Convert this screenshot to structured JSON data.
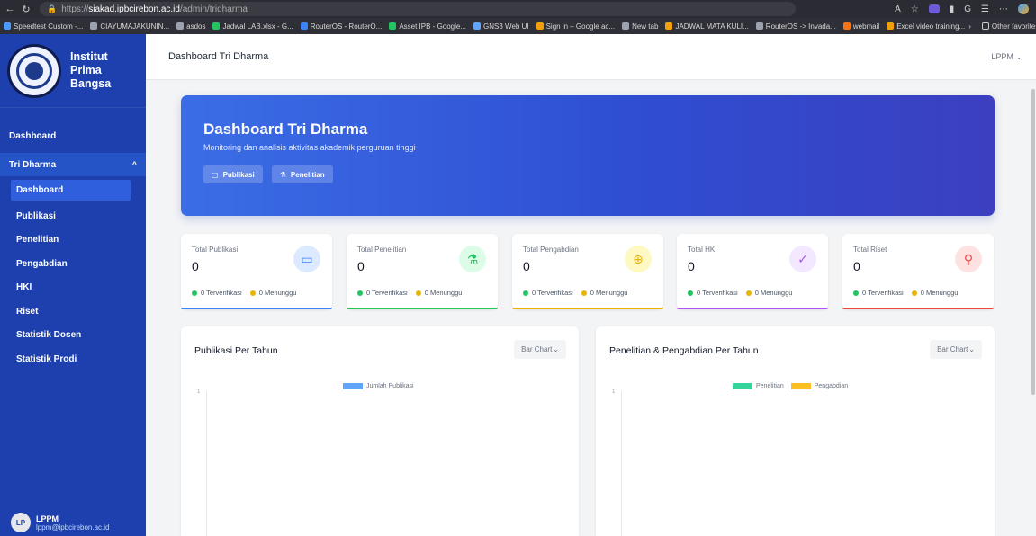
{
  "browser": {
    "url_prefix": "https://",
    "url_host": "siakad.ipbcirebon.ac.id",
    "url_path": "/admin/tridharma",
    "bookmarks": [
      {
        "label": "Speedtest Custom -...",
        "color": "#4b9bff"
      },
      {
        "label": "CIAYUMAJAKUNIN...",
        "color": "#9ca3af"
      },
      {
        "label": "asdos",
        "color": "#9ca3af"
      },
      {
        "label": "Jadwal LAB.xlsx - G...",
        "color": "#22c55e"
      },
      {
        "label": "RouterOS - RouterO...",
        "color": "#3b82f6"
      },
      {
        "label": "Asset IPB - Google...",
        "color": "#22c55e"
      },
      {
        "label": "GNS3 Web UI",
        "color": "#60a5fa"
      },
      {
        "label": "Sign in – Google ac...",
        "color": "#f59e0b"
      },
      {
        "label": "New tab",
        "color": "#9ca3af"
      },
      {
        "label": "JADWAL MATA KULI...",
        "color": "#f59e0b"
      },
      {
        "label": "RouterOS -> Invada...",
        "color": "#9ca3af"
      },
      {
        "label": "webmail",
        "color": "#f97316"
      },
      {
        "label": "Excel video training...",
        "color": "#f59e0b"
      }
    ],
    "other_favorites": "Other favorites"
  },
  "sidebar": {
    "brand_line1": "Institut",
    "brand_line2": "Prima",
    "brand_line3": "Bangsa",
    "dashboard": "Dashboard",
    "group": "Tri Dharma",
    "items": [
      "Dashboard",
      "Publikasi",
      "Penelitian",
      "Pengabdian",
      "HKI",
      "Riset",
      "Statistik Dosen",
      "Statistik Prodi"
    ],
    "user_initials": "LP",
    "user_name": "LPPM",
    "user_email": "lppm@ipbcirebon.ac.id"
  },
  "header": {
    "title": "Dashboard Tri Dharma",
    "user_menu": "LPPM"
  },
  "hero": {
    "title": "Dashboard Tri Dharma",
    "subtitle": "Monitoring dan analisis aktivitas akademik perguruan tinggi",
    "btn_publikasi": "Publikasi",
    "btn_penelitian": "Penelitian"
  },
  "stats": [
    {
      "label": "Total Publikasi",
      "value": "0",
      "verified": "0 Terverifikasi",
      "pending": "0 Menunggu",
      "icon": "book-icon",
      "color": "#3b82f6",
      "bg": "#dbeafe"
    },
    {
      "label": "Total Penelitian",
      "value": "0",
      "verified": "0 Terverifikasi",
      "pending": "0 Menunggu",
      "icon": "flask-icon",
      "color": "#22c55e",
      "bg": "#dcfce7"
    },
    {
      "label": "Total Pengabdian",
      "value": "0",
      "verified": "0 Terverifikasi",
      "pending": "0 Menunggu",
      "icon": "globe-icon",
      "color": "#eab308",
      "bg": "#fef9c3"
    },
    {
      "label": "Total HKI",
      "value": "0",
      "verified": "0 Terverifikasi",
      "pending": "0 Menunggu",
      "icon": "badge-check-icon",
      "color": "#a855f7",
      "bg": "#f3e8ff"
    },
    {
      "label": "Total Riset",
      "value": "0",
      "verified": "0 Terverifikasi",
      "pending": "0 Menunggu",
      "icon": "search-icon",
      "color": "#ef4444",
      "bg": "#fee2e2"
    }
  ],
  "charts": {
    "left": {
      "title": "Publikasi Per Tahun",
      "select": "Bar Chart",
      "legend": [
        "Jumlah Publikasi"
      ],
      "legend_colors": [
        "#60a5fa"
      ],
      "tick": "1"
    },
    "right": {
      "title": "Penelitian & Pengabdian Per Tahun",
      "select": "Bar Chart",
      "legend": [
        "Penelitian",
        "Pengabdian"
      ],
      "legend_colors": [
        "#34d399",
        "#fbbf24"
      ],
      "tick": "1"
    }
  },
  "colors": {
    "sidebar": "#1e40af",
    "accent": "#2f5fdc"
  }
}
